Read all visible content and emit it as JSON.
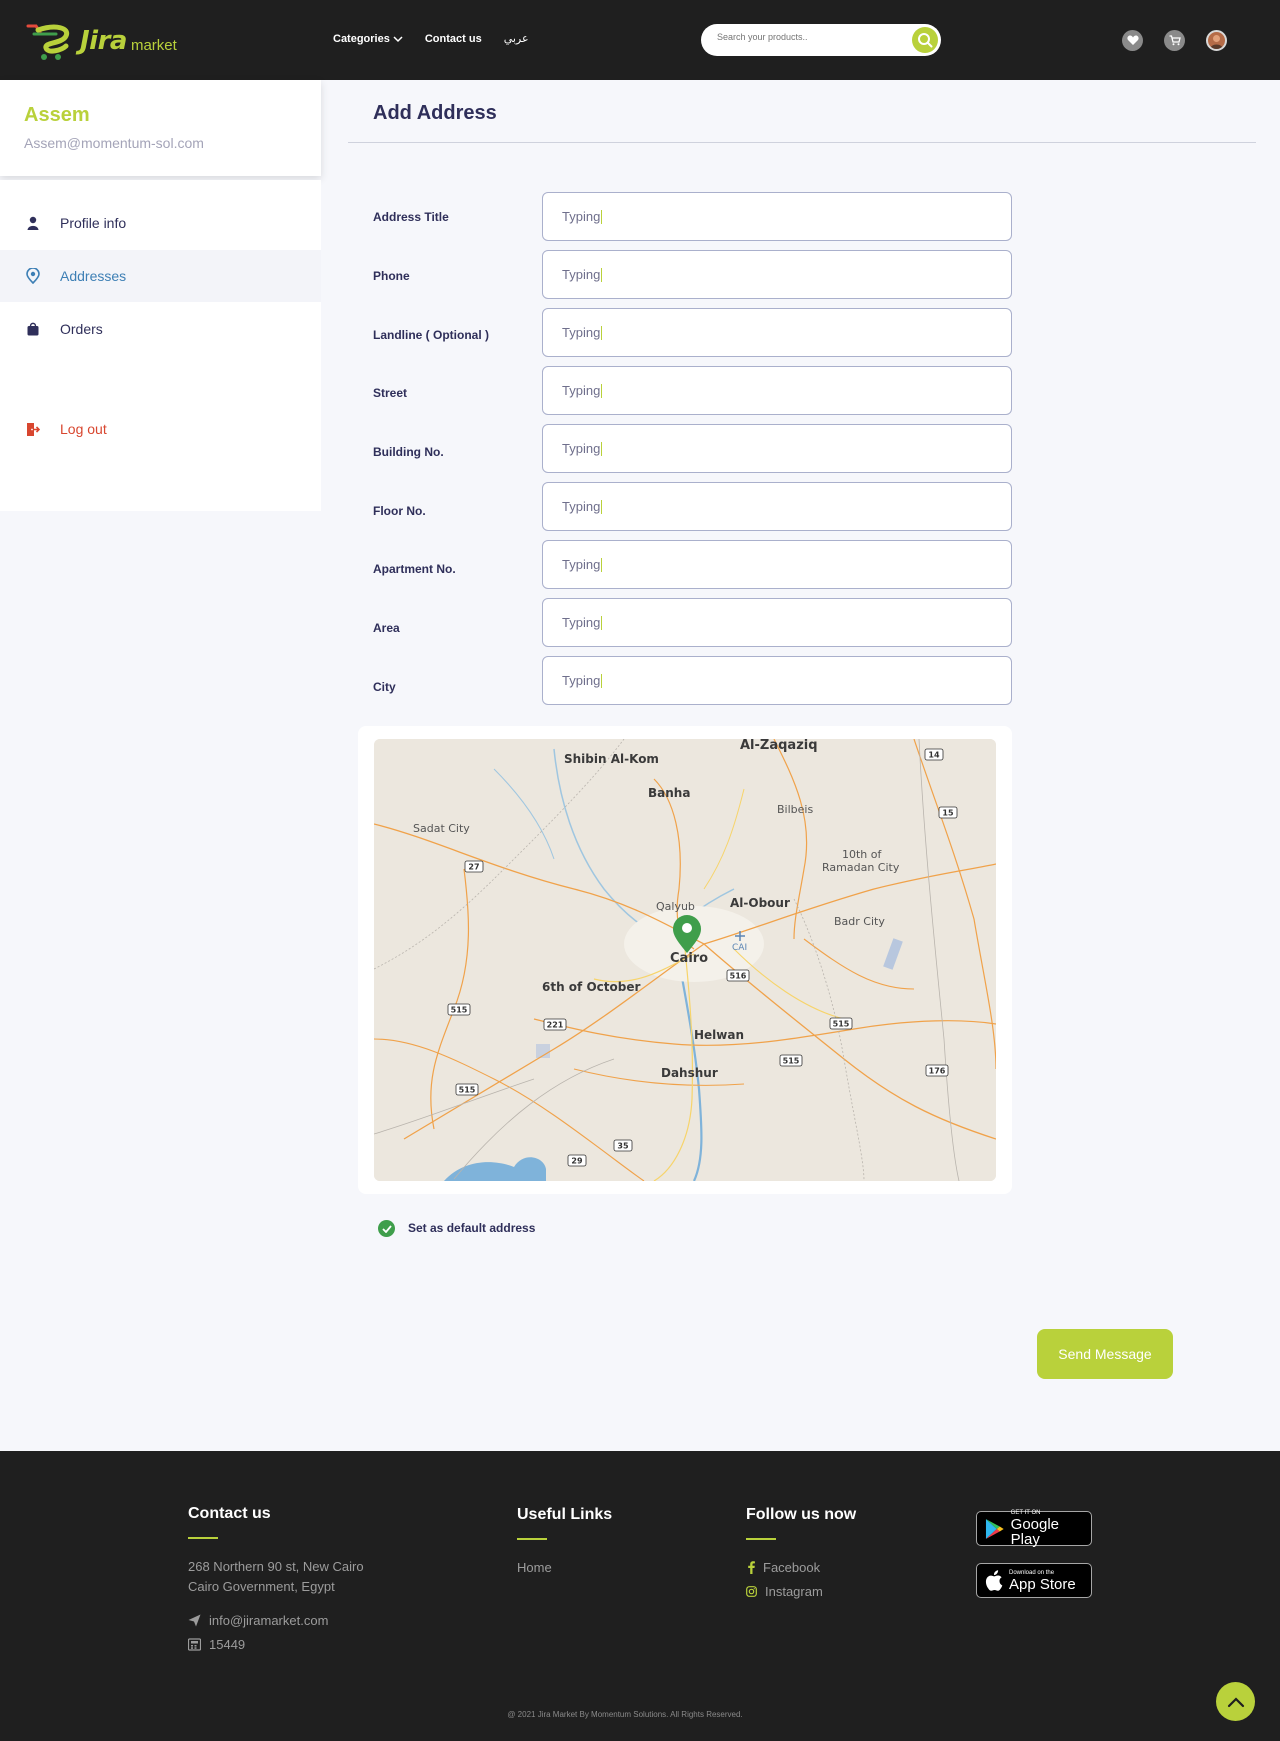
{
  "header": {
    "logo_text": "Jira",
    "logo_sub": "market",
    "nav": {
      "categories": "Categories",
      "contact": "Contact us",
      "arabic": "عربي"
    },
    "search_placeholder": "Search your products..",
    "icons": [
      "heart-icon",
      "cart-icon",
      "user-avatar"
    ]
  },
  "profile": {
    "name": "Assem",
    "email": "Assem@momentum-sol.com"
  },
  "sidebar": {
    "items": [
      {
        "label": "Profile info",
        "icon": "user-icon"
      },
      {
        "label": "Addresses",
        "icon": "location-pin-icon",
        "active": true
      },
      {
        "label": "Orders",
        "icon": "shopping-bag-icon"
      },
      {
        "label": "Log out",
        "icon": "logout-icon"
      }
    ]
  },
  "main": {
    "title": "Add Address",
    "fields": [
      {
        "label": "Address Title",
        "value": "Typing"
      },
      {
        "label": "Phone",
        "value": "Typing"
      },
      {
        "label": "Landline ( Optional )",
        "value": "Typing"
      },
      {
        "label": "Street",
        "value": "Typing"
      },
      {
        "label": "Building No.",
        "value": "Typing"
      },
      {
        "label": "Floor No.",
        "value": "Typing"
      },
      {
        "label": "Apartment No.",
        "value": "Typing"
      },
      {
        "label": "Area",
        "value": "Typing"
      },
      {
        "label": "City",
        "value": "Typing"
      }
    ],
    "map": {
      "places": [
        "Shibin Al-Kom",
        "Al-Zaqaziq",
        "Banha",
        "Bilbeis",
        "Sadat City",
        "10th of",
        "Ramadan City",
        "Qalyub",
        "Al-Obour",
        "Badr City",
        "Cairo",
        "CAI",
        "6th of October",
        "Helwan",
        "Dahshur"
      ],
      "road_badges": [
        "14",
        "15",
        "27",
        "516",
        "515",
        "221",
        "515",
        "515",
        "176",
        "515",
        "35",
        "29"
      ]
    },
    "default_address_label": "Set as default address",
    "send_button": "Send Message"
  },
  "footer": {
    "contact_heading": "Contact us",
    "address_line1": "268 Northern 90 st, New Cairo",
    "address_line2": "Cairo Government, Egypt",
    "email": "info@jiramarket.com",
    "phone": "15449",
    "links_heading": "Useful Links",
    "links": [
      "Home"
    ],
    "follow_heading": "Follow us now",
    "social": [
      "Facebook",
      "Instagram"
    ],
    "google_play_small": "GET IT ON",
    "google_play_big": "Google Play",
    "app_store_small": "Download on the",
    "app_store_big": "App Store",
    "copyright": "@ 2021 Jira Market By Momentum Solutions. All Rights Reserved."
  },
  "colors": {
    "accent": "#b9d13b",
    "header_bg": "#1f1f1f",
    "text_dark": "#2f2f5a",
    "active_blue": "#3d7fb5",
    "logout_red": "#d8462f",
    "check_green": "#3f9e4b"
  }
}
